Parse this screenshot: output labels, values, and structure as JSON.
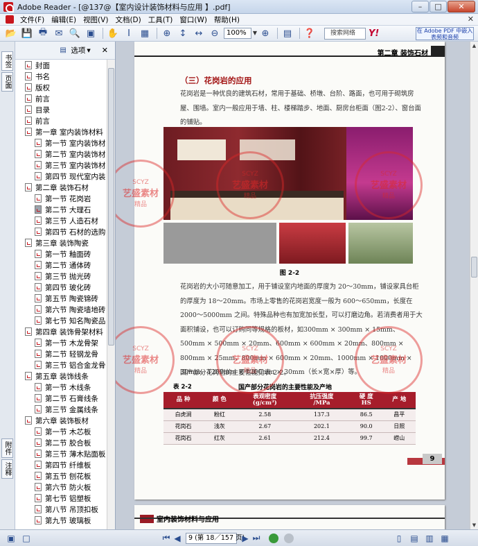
{
  "window": {
    "title": "Adobe Reader - [@137@【室内设计装饰材料与应用 】.pdf]",
    "minimize": "–",
    "maximize": "□",
    "close": "✕"
  },
  "menu": {
    "items": [
      "文件(F)",
      "编辑(E)",
      "视图(V)",
      "文档(D)",
      "工具(T)",
      "窗口(W)",
      "帮助(H)"
    ],
    "close_glyph": "✕"
  },
  "toolbar": {
    "zoom_value": "100%",
    "search_placeholder": "搜索网络",
    "yahoo": "Y!",
    "adobe_ad": "在 Adobe PDF 中嵌入表频和音频"
  },
  "left_tabs": {
    "bookmarks": "书签",
    "pages": "页面",
    "attachments": "附件",
    "comments": "注释"
  },
  "bookmarks": {
    "options_label": "选项",
    "close_glyph": "✕",
    "items": [
      {
        "label": "封面",
        "level": 0
      },
      {
        "label": "书名",
        "level": 0
      },
      {
        "label": "版权",
        "level": 0
      },
      {
        "label": "前言",
        "level": 0
      },
      {
        "label": "目录",
        "level": 0
      },
      {
        "label": "前言",
        "level": 0
      },
      {
        "label": "第一章  室内装饰材料",
        "level": 0
      },
      {
        "label": "第一节  室内装饰材",
        "level": 1
      },
      {
        "label": "第二节  室内装饰材",
        "level": 1
      },
      {
        "label": "第三节  室内装饰材",
        "level": 1
      },
      {
        "label": "第四节  现代室内装",
        "level": 1
      },
      {
        "label": "第二章  装饰石材",
        "level": 0
      },
      {
        "label": "第一节  花岗岩",
        "level": 1
      },
      {
        "label": "第二节  大理石",
        "level": 1,
        "selected": true
      },
      {
        "label": "第三节  人造石材",
        "level": 1
      },
      {
        "label": "第四节  石材的选购",
        "level": 1
      },
      {
        "label": "第三章  装饰陶瓷",
        "level": 0
      },
      {
        "label": "第一节  釉面砖",
        "level": 1
      },
      {
        "label": "第二节  通体砖",
        "level": 1
      },
      {
        "label": "第三节  抛光砖",
        "level": 1
      },
      {
        "label": "第四节  玻化砖",
        "level": 1
      },
      {
        "label": "第五节  陶瓷锦砖",
        "level": 1
      },
      {
        "label": "第六节  陶瓷墙地砖",
        "level": 1
      },
      {
        "label": "第七节  知名陶瓷品",
        "level": 1
      },
      {
        "label": "第四章  装饰骨架材料",
        "level": 0
      },
      {
        "label": "第一节  木龙骨架",
        "level": 1
      },
      {
        "label": "第二节  轻钢龙骨",
        "level": 1
      },
      {
        "label": "第三节  铝合金龙骨",
        "level": 1
      },
      {
        "label": "第五章  装饰线条",
        "level": 0
      },
      {
        "label": "第一节  木线条",
        "level": 1
      },
      {
        "label": "第二节  石膏线条",
        "level": 1
      },
      {
        "label": "第三节  金属线条",
        "level": 1
      },
      {
        "label": "第六章  装饰板材",
        "level": 0
      },
      {
        "label": "第一节  木芯板",
        "level": 1
      },
      {
        "label": "第二节  胶合板",
        "level": 1
      },
      {
        "label": "第三节  薄木贴面板",
        "level": 1
      },
      {
        "label": "第四节  纤维板",
        "level": 1
      },
      {
        "label": "第五节  刨花板",
        "level": 1
      },
      {
        "label": "第六节  防火板",
        "level": 1
      },
      {
        "label": "第七节  铝塑板",
        "level": 1
      },
      {
        "label": "第八节  吊顶扣板",
        "level": 1
      },
      {
        "label": "第九节  玻璃板",
        "level": 1
      }
    ]
  },
  "page": {
    "header": "第二章  装饰石材",
    "section_title": "（三）花岗岩的应用",
    "para1": "花岗岩是一种优良的建筑石材，常用于基础、桥墩、台阶、路面，也可用于砌筑房屋、围墙。室内一般应用于墙、柱、楼梯踏步、地面、厨房台柜面（图2-2）、窗台面的铺贴。",
    "figure_caption": "图 2-2",
    "para2": "花岗岩的大小可随意加工，用于铺设室内地面的厚度为 20～30mm，铺设家具台柜的厚度为 18～20mm。市场上零售的花岗岩宽度一般为 600～650mm，长度在 2000～5000mm 之间。特殊品种也有加宽加长型，可以打磨边角。若消费者用于大面积铺设，也可以订购同等规格的板材，如300mm × 300mm × 15mm、500mm × 500mm × 20mm、600mm × 600mm × 20mm、800mm × 800mm × 25mm、800mm × 600mm × 20mm、1000mm × 1000mm × 30mm、1200mm × 1200mm × 30mm（长×宽×厚）等。",
    "para3": "国产部分花岗岩的主要性能见表 2-2。",
    "table_label": "表 2-2",
    "table_title": "国产部分花岗岩的主要性能及产地",
    "table": {
      "headers": [
        "品 种",
        "颜 色",
        "表观密度\n(g/cm³)",
        "抗压强度\n/MPa",
        "硬 度\nHS",
        "产 地"
      ],
      "rows": [
        [
          "白虎涧",
          "粉红",
          "2.58",
          "137.3",
          "86.5",
          "昌平"
        ],
        [
          "花岗石",
          "浅灰",
          "2.67",
          "202.1",
          "90.0",
          "日照"
        ],
        [
          "花岗石",
          "红灰",
          "2.61",
          "212.4",
          "99.7",
          "崂山"
        ]
      ]
    },
    "page_number": "9",
    "next_page_header": "室内装饰材料与应用"
  },
  "watermark": {
    "line1": "艺盛素材",
    "line2": "精品",
    "line3": "SCYZ"
  },
  "status": {
    "page_field": "9 (第 18／157 页)"
  },
  "colors": {
    "accent_red": "#a61d2b",
    "toolbar_blue": "#2a4d8f"
  }
}
